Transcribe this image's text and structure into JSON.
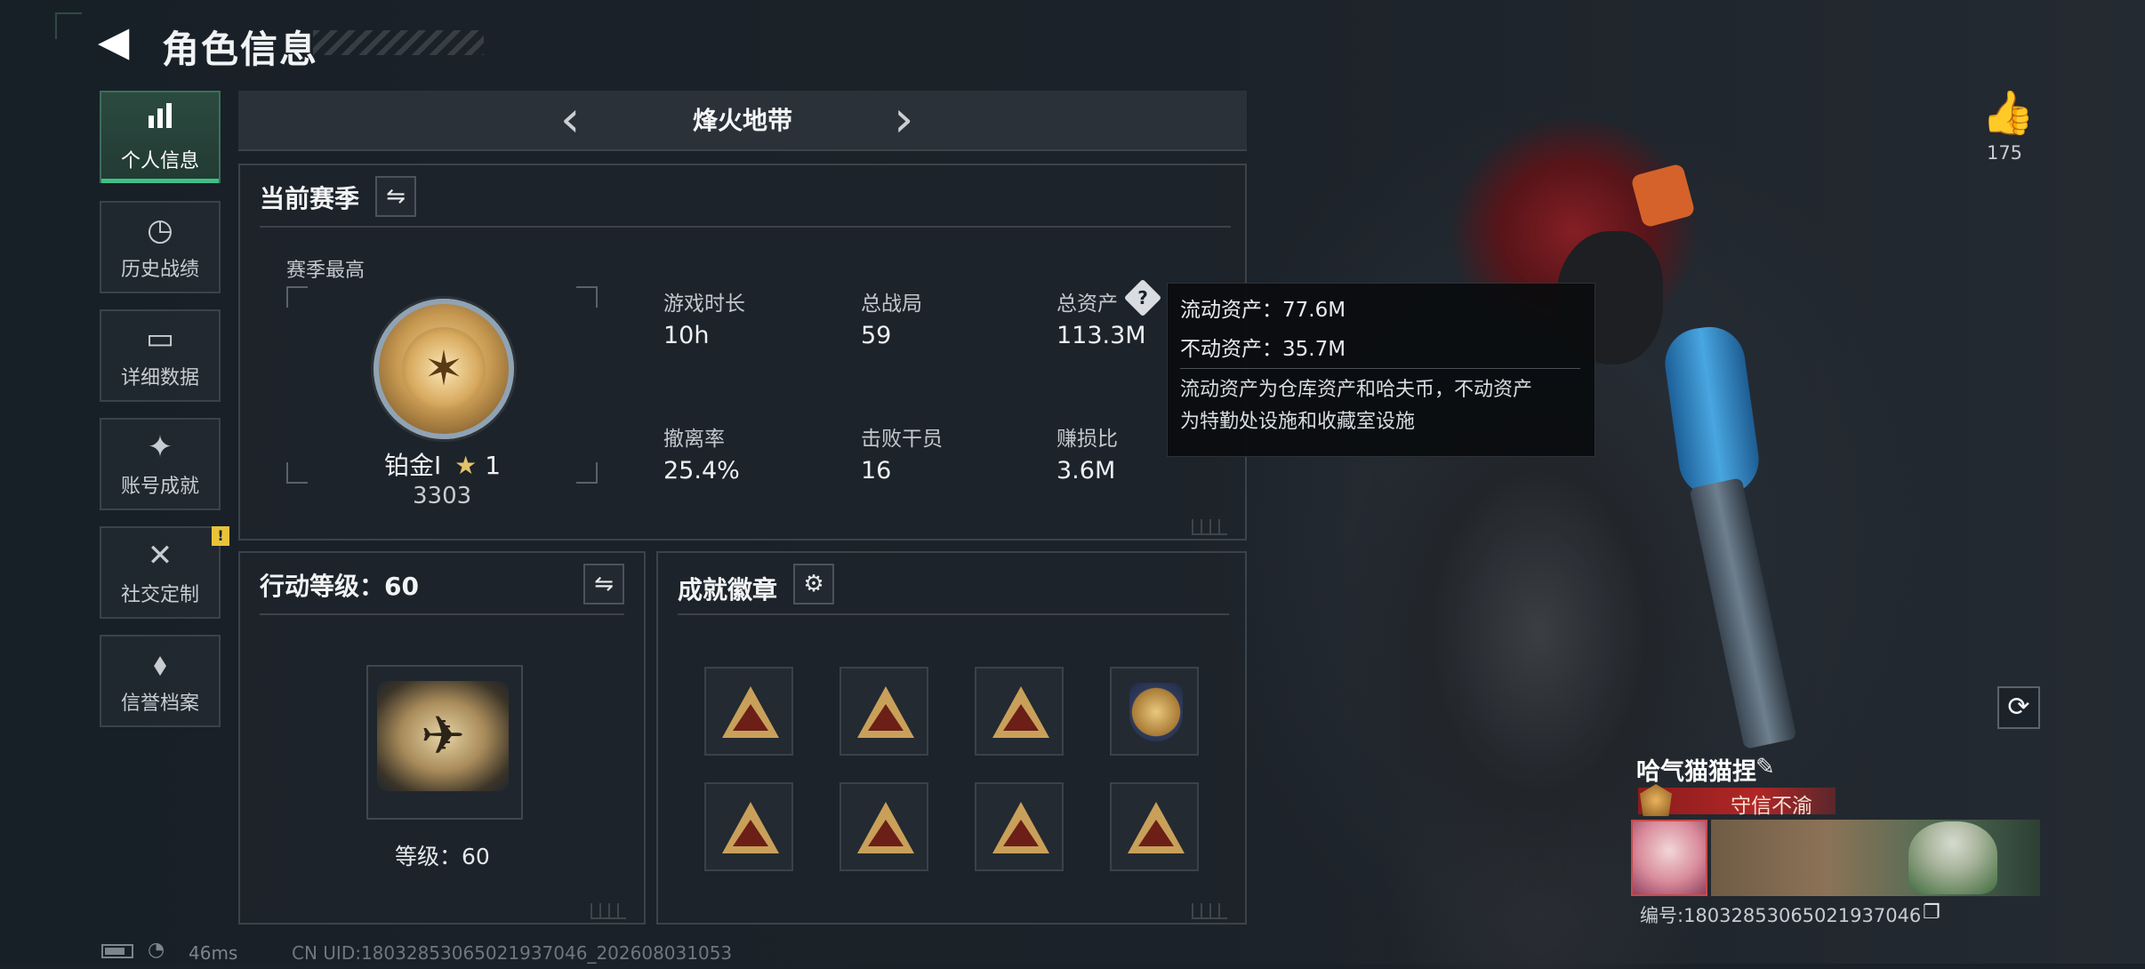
{
  "header": {
    "title": "角色信息",
    "back_icon": "back-arrow-icon"
  },
  "sidebar": {
    "items": [
      {
        "label": "个人信息",
        "icon": "bar-chart-icon",
        "glyph": "▮",
        "active": true
      },
      {
        "label": "历史战绩",
        "icon": "history-clock-icon",
        "glyph": "◷",
        "active": false
      },
      {
        "label": "详细数据",
        "icon": "folder-icon",
        "glyph": "▭",
        "active": false
      },
      {
        "label": "账号成就",
        "icon": "achievement-icon",
        "glyph": "✦",
        "active": false
      },
      {
        "label": "社交定制",
        "icon": "tools-icon",
        "glyph": "✕",
        "active": false,
        "badge": "!"
      },
      {
        "label": "信誉档案",
        "icon": "reputation-icon",
        "glyph": "⬧",
        "active": false
      }
    ]
  },
  "mode_selector": {
    "title": "烽火地带",
    "prev_glyph": "‹",
    "next_glyph": "›"
  },
  "season_panel": {
    "title": "当前赛季",
    "swap_glyph": "⇋",
    "peak_label": "赛季最高",
    "rank_name": "铂金Ⅰ",
    "rank_star_glyph": "★",
    "rank_stars": "1",
    "rank_points": "3303",
    "stats": [
      {
        "label": "游戏时长",
        "value": "10h"
      },
      {
        "label": "总战局",
        "value": "59"
      },
      {
        "label": "总资产",
        "value": "113.3M"
      },
      {
        "label": "撤离率",
        "value": "25.4%"
      },
      {
        "label": "击败干员",
        "value": "16"
      },
      {
        "label": "赚损比",
        "value": "3.6M"
      }
    ],
    "help_glyph": "?"
  },
  "tooltip": {
    "liquid": "流动资产：77.6M",
    "fixed": "不动资产：35.7M",
    "desc_line1": "流动资产为仓库资产和哈夫币，不动资产",
    "desc_line2": "为特勤处设施和收藏室设施"
  },
  "level_panel": {
    "title": "行动等级：60",
    "swap_glyph": "⇋",
    "level_caption": "等级：60"
  },
  "badges_panel": {
    "title": "成就徽章",
    "settings_glyph": "⚙",
    "badges": [
      {
        "icon": "badge-crate-icon",
        "shape": "tri"
      },
      {
        "icon": "badge-camp-icon",
        "shape": "tri"
      },
      {
        "icon": "badge-squad-icon",
        "shape": "tri"
      },
      {
        "icon": "badge-shield-icon",
        "shape": "shield"
      },
      {
        "icon": "badge-boat-icon",
        "shape": "tri"
      },
      {
        "icon": "badge-first-icon",
        "shape": "tri"
      },
      {
        "icon": "badge-fifty-icon",
        "shape": "tri"
      },
      {
        "icon": "badge-device-icon",
        "shape": "tri"
      }
    ]
  },
  "right_panel": {
    "like_glyph": "👍",
    "like_count": "175",
    "refresh_glyph": "⟳",
    "player_name": "哈气猫猫捏",
    "edit_glyph": "✎",
    "player_title": "守信不渝",
    "uid_text": "编号:18032853065021937046",
    "copy_glyph": "❐"
  },
  "status_bar": {
    "battery_level": 0.8,
    "wifi_glyph": "◔",
    "ping": "46ms",
    "uid": "CN UID:18032853065021937046_202608031053"
  }
}
